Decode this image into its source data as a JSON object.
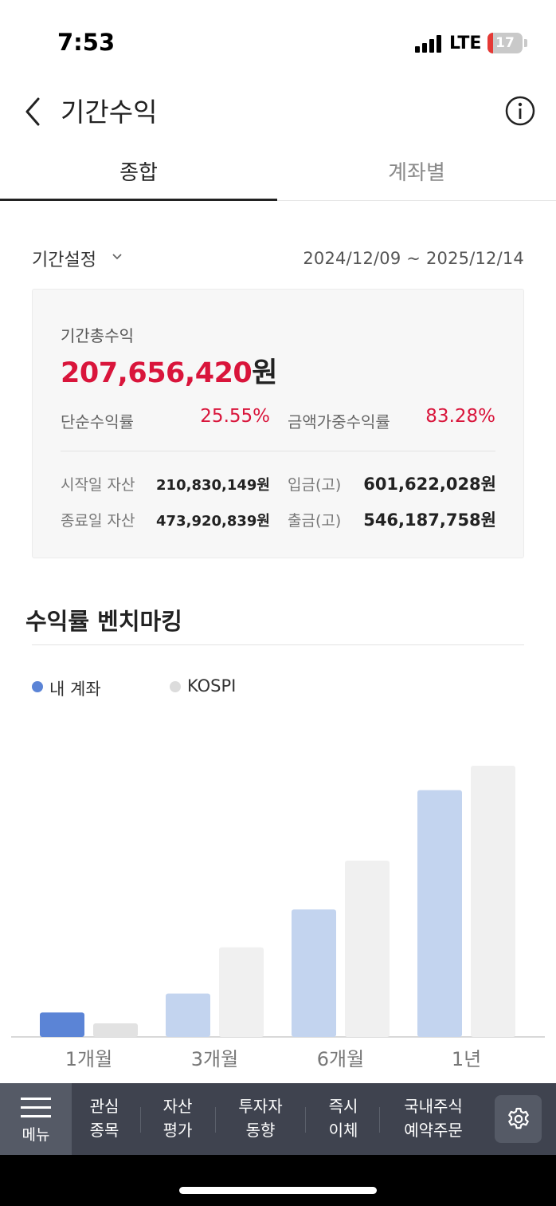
{
  "status_bar": {
    "time": "7:53",
    "network": "LTE",
    "battery": "17",
    "battery_level_percent": 17
  },
  "header": {
    "title": "기간수익",
    "back_icon": "chevron-left-icon",
    "info_icon": "info-icon"
  },
  "tabs": [
    {
      "label": "종합",
      "active": true
    },
    {
      "label": "계좌별",
      "active": false
    }
  ],
  "period": {
    "setting_label": "기간설정",
    "range": "2024/12/09 ~ 2025/12/14"
  },
  "summary": {
    "total_label": "기간총수익",
    "total_amount": "207,656,420",
    "total_unit": "원",
    "simple_rate_label": "단순수익률",
    "simple_rate_value": "25.55%",
    "weighted_rate_label": "금액가중수익률",
    "weighted_rate_value": "83.28%",
    "start_asset_label": "시작일 자산",
    "start_asset_value": "210,830,149원",
    "end_asset_label": "종료일 자산",
    "end_asset_value": "473,920,839원",
    "deposit_label": "입금(고)",
    "deposit_value": "601,622,028원",
    "withdraw_label": "출금(고)",
    "withdraw_value": "546,187,758원"
  },
  "benchmark": {
    "title": "수익률 벤치마킹",
    "legend": [
      {
        "label": "내 계좌",
        "color": "#5b84d6"
      },
      {
        "label": "KOSPI",
        "color": "#dcdcdc"
      }
    ]
  },
  "chart_data": {
    "type": "bar",
    "categories": [
      "1개월",
      "3개월",
      "6개월",
      "1년"
    ],
    "series": [
      {
        "name": "내 계좌",
        "values": [
          9,
          16,
          47,
          91
        ]
      },
      {
        "name": "KOSPI",
        "values": [
          5,
          33,
          65,
          100
        ]
      }
    ],
    "title": "",
    "xlabel": "",
    "ylabel": "",
    "ylim": [
      0,
      100
    ],
    "grid": false,
    "legend": "top-left",
    "colors": {
      "my_selected": "#5b84d6",
      "my_default": "#c3d4ef",
      "kospi": "#f0f0f0",
      "kospi_selected": "#e2e2e2"
    }
  },
  "bottom_nav": {
    "menu_label": "메뉴",
    "items": [
      {
        "line1": "관심",
        "line2": "종목"
      },
      {
        "line1": "자산",
        "line2": "평가"
      },
      {
        "line1": "투자자",
        "line2": "동향"
      },
      {
        "line1": "즉시",
        "line2": "이체"
      },
      {
        "line1": "국내주식",
        "line2": "예약주문"
      }
    ],
    "settings_icon": "gear-icon"
  }
}
